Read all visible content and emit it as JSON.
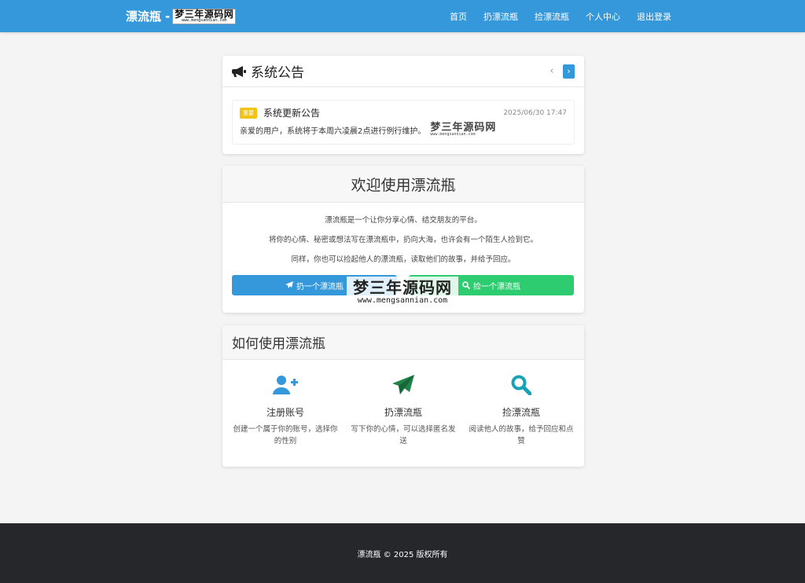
{
  "navbar": {
    "brand": "漂流瓶",
    "brand_sep": "-",
    "logo_main": "梦三年源码网",
    "logo_sub": "www.mengsannian.com",
    "links": [
      "首页",
      "扔漂流瓶",
      "捡漂流瓶",
      "个人中心",
      "退出登录"
    ]
  },
  "announcement": {
    "title": "系统公告",
    "prev": "‹",
    "next": "›",
    "item": {
      "badge": "重要",
      "title": "系统更新公告",
      "date": "2025/06/30 17:47",
      "body": "亲爱的用户，系统将于本周六凌晨2点进行例行维护。",
      "watermark_main": "梦三年源码网",
      "watermark_sub": "www.mengsannian.com"
    }
  },
  "welcome": {
    "title": "欢迎使用漂流瓶",
    "paragraphs": [
      "漂流瓶是一个让你分享心情、结交朋友的平台。",
      "将你的心情、秘密或想法写在漂流瓶中，扔向大海，也许会有一个陌生人捡到它。",
      "同样，你也可以捡起他人的漂流瓶，读取他们的故事，并给予回应。"
    ],
    "throw_btn": "扔一个漂流瓶",
    "pick_btn": "捡一个漂流瓶",
    "watermark_main": "梦三年源码网",
    "watermark_sub": "www.mengsannian.com"
  },
  "howto": {
    "title": "如何使用漂流瓶",
    "steps": [
      {
        "icon": "user-plus-icon",
        "color": "#3498db",
        "title": "注册账号",
        "desc": "创建一个属于你的账号，选择你的性别"
      },
      {
        "icon": "paper-plane-icon",
        "color": "#1e8449",
        "title": "扔漂流瓶",
        "desc": "写下你的心情，可以选择匿名发送"
      },
      {
        "icon": "search-icon",
        "color": "#17a2b8",
        "title": "捡漂流瓶",
        "desc": "阅读他人的故事，给予回应和点赞"
      }
    ]
  },
  "footer": {
    "text": "漂流瓶 © 2025 版权所有"
  },
  "colors": {
    "primary": "#3498db",
    "success": "#2ecc71",
    "warning": "#f1c40f",
    "footer_bg": "#25272b"
  }
}
